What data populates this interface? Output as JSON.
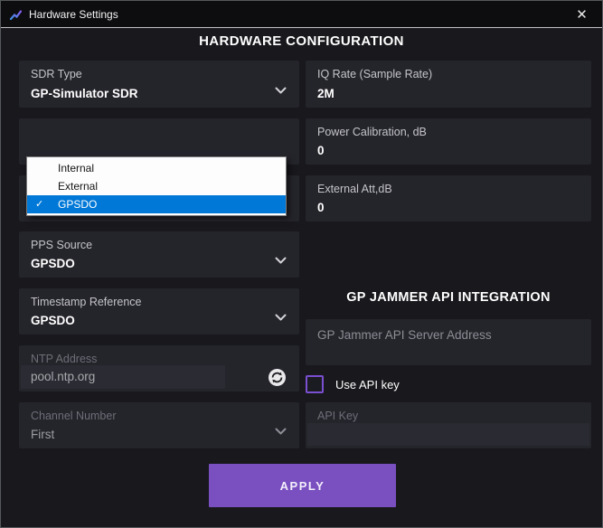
{
  "window": {
    "title": "Hardware Settings",
    "close_glyph": "✕"
  },
  "heading": "HARDWARE CONFIGURATION",
  "left_column": {
    "sdr_type": {
      "label": "SDR Type",
      "value": "GP-Simulator SDR"
    },
    "pps_source": {
      "label": "PPS Source",
      "value": "GPSDO"
    },
    "timestamp_reference": {
      "label": "Timestamp Reference",
      "value": "GPSDO"
    },
    "ntp_address": {
      "label": "NTP Address",
      "value": "pool.ntp.org"
    },
    "channel_number": {
      "label": "Channel Number",
      "value": "First"
    }
  },
  "dropdown_menu": {
    "checkmark": "✓",
    "items": [
      {
        "label": "Internal",
        "selected": false
      },
      {
        "label": "External",
        "selected": false
      },
      {
        "label": "GPSDO",
        "selected": true
      }
    ]
  },
  "right_column": {
    "iq_rate": {
      "label": "IQ Rate (Sample Rate)",
      "value": "2M"
    },
    "power_calibration": {
      "label": "Power Calibration, dB",
      "value": "0"
    },
    "external_att": {
      "label": "External Att,dB",
      "value": "0"
    },
    "section_heading": "GP JAMMER API INTEGRATION",
    "server_address": {
      "placeholder": "GP Jammer API Server Address"
    },
    "use_api_key": {
      "label": "Use API key",
      "checked": false
    },
    "api_key": {
      "label": "API Key",
      "value": ""
    }
  },
  "apply_button": "APPLY",
  "colors": {
    "accent": "#7a50c0",
    "menu_highlight": "#0078d7",
    "checkbox_border": "#7a4fd0",
    "field_background": "#24242b",
    "window_background": "#18181d",
    "titlebar_background": "#0d0d10"
  }
}
